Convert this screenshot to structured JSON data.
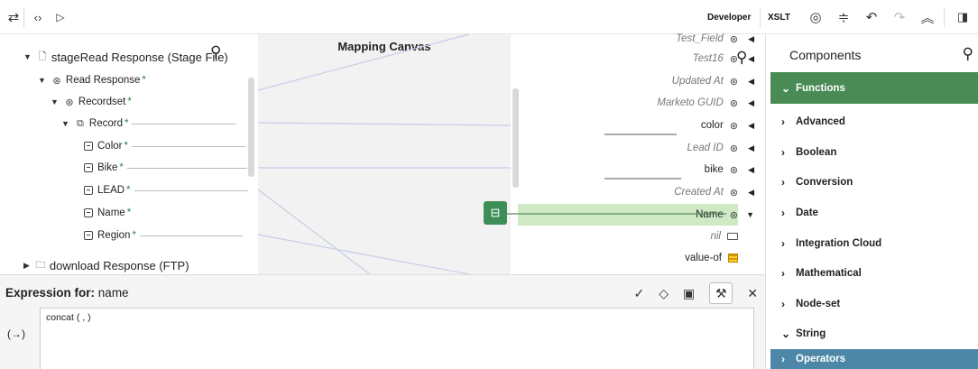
{
  "toolbar": {
    "developer_label": "Developer",
    "xslt_label": "XSLT"
  },
  "source_tree": {
    "root_label": "stageRead Response (Stage File)",
    "read_response": "Read Response",
    "recordset": "Recordset",
    "record": "Record",
    "fields": [
      "Color",
      "Bike",
      "LEAD",
      "Name",
      "Region"
    ],
    "download_label": "download Response (FTP)",
    "required_marker": "*"
  },
  "canvas": {
    "title": "Mapping Canvas"
  },
  "target_tree": {
    "items": [
      {
        "label": "Test_Field",
        "italic": true
      },
      {
        "label": "Test16",
        "italic": true
      },
      {
        "label": "Updated At",
        "italic": true
      },
      {
        "label": "Marketo GUID",
        "italic": true
      },
      {
        "label": "color",
        "italic": false
      },
      {
        "label": "Lead ID",
        "italic": true
      },
      {
        "label": "bike",
        "italic": false
      },
      {
        "label": "Created At",
        "italic": true
      },
      {
        "label": "Name",
        "italic": false
      },
      {
        "label": "nil",
        "italic": true
      },
      {
        "label": "value-of",
        "italic": false
      }
    ]
  },
  "expression": {
    "title_prefix": "Expression for:",
    "title_target": "name",
    "text": "concat ( , )",
    "left_marker": "(→)"
  },
  "components": {
    "title": "Components",
    "categories": [
      {
        "label": "Functions",
        "expanded": true,
        "style": "func"
      },
      {
        "label": "Advanced",
        "expanded": false
      },
      {
        "label": "Boolean",
        "expanded": false
      },
      {
        "label": "Conversion",
        "expanded": false
      },
      {
        "label": "Date",
        "expanded": false
      },
      {
        "label": "Integration Cloud",
        "expanded": false
      },
      {
        "label": "Mathematical",
        "expanded": false
      },
      {
        "label": "Node-set",
        "expanded": false
      },
      {
        "label": "String",
        "expanded": true
      },
      {
        "label": "Operators",
        "expanded": false,
        "style": "ops"
      }
    ]
  },
  "colors": {
    "functions_bg": "#4a8a55",
    "operators_bg": "#4d87a8",
    "selected_row": "#cfe9c5",
    "required_star": "#2e8540"
  }
}
